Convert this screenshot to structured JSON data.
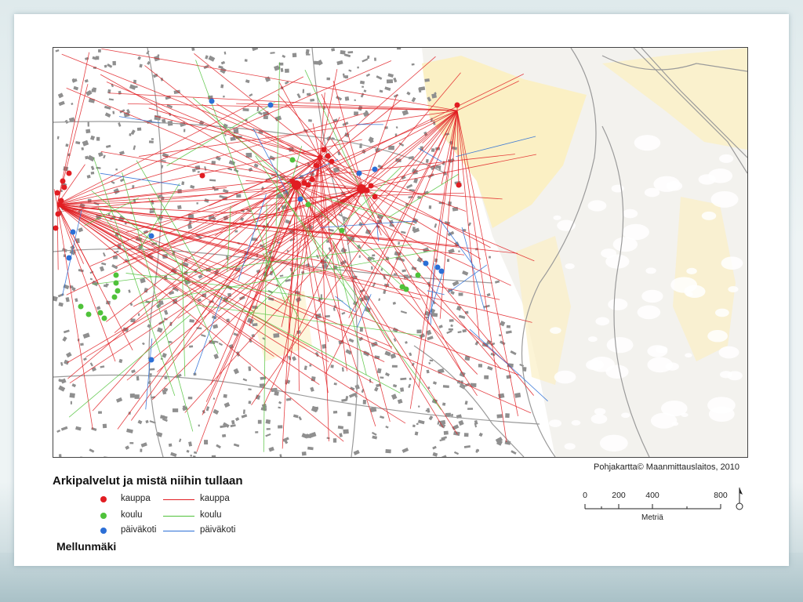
{
  "map": {
    "title": "Arkipalvelut ja mistä niihin tullaan",
    "place_name": "Mellunmäki",
    "credit": "Pohjakartta© Maanmittauslaitos,  2010",
    "legend": [
      {
        "point_label": "kauppa",
        "line_label": "kauppa",
        "color": "#e11d22"
      },
      {
        "point_label": "koulu",
        "line_label": "koulu",
        "color": "#4fc23a"
      },
      {
        "point_label": "päiväkoti",
        "line_label": "päiväkoti",
        "color": "#2c6fd6"
      }
    ],
    "scale": {
      "ticks": [
        "0",
        "200",
        "400",
        "800"
      ],
      "unit": "Metriä"
    },
    "colors": {
      "kauppa": "#e11d22",
      "koulu": "#4fc23a",
      "paivakoti": "#2c6fd6",
      "built_area": "#ffffff",
      "forest": "#f3f2ee",
      "field": "#fbf0c4",
      "buildings": "#8f8f8f",
      "roads": "#9a9a9a"
    },
    "north_arrow_icon": "north-arrow-icon"
  }
}
